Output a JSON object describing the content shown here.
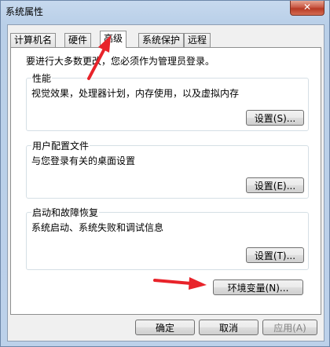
{
  "window": {
    "title": "系统属性",
    "close_glyph": "✕"
  },
  "tabs": [
    {
      "label": "计算机名"
    },
    {
      "label": "硬件"
    },
    {
      "label": "高级"
    },
    {
      "label": "系统保护"
    },
    {
      "label": "远程"
    }
  ],
  "panel": {
    "notice": "要进行大多数更改，您必须作为管理员登录。",
    "performance": {
      "title": "性能",
      "desc": "视觉效果，处理器计划，内存使用，以及虚拟内存",
      "button": "设置(S)..."
    },
    "user_profiles": {
      "title": "用户配置文件",
      "desc": "与您登录有关的桌面设置",
      "button": "设置(E)..."
    },
    "startup_recovery": {
      "title": "启动和故障恢复",
      "desc": "系统启动、系统失败和调试信息",
      "button": "设置(T)..."
    },
    "env_button": "环境变量(N)..."
  },
  "footer": {
    "ok": "确定",
    "cancel": "取消",
    "apply": "应用(A)"
  },
  "annotations": {
    "arrow_color": "#e8232a"
  }
}
